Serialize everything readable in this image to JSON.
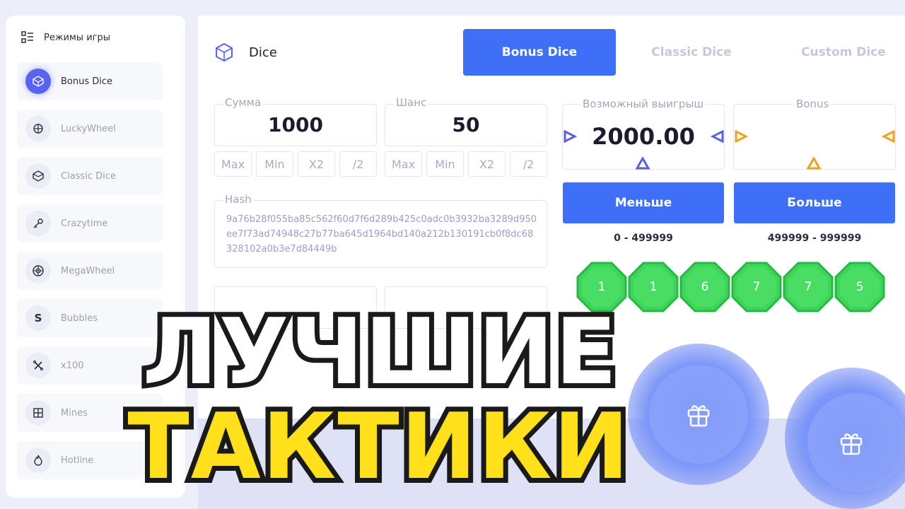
{
  "sidebar": {
    "title": "Режимы игры",
    "title_icon": "list-icon",
    "items": [
      {
        "label": "Bonus Dice",
        "icon": "dice-icon"
      },
      {
        "label": "LuckyWheel",
        "icon": "wheel-icon"
      },
      {
        "label": "Classic Dice",
        "icon": "dice-icon"
      },
      {
        "label": "Crazytime",
        "icon": "key-icon"
      },
      {
        "label": "MegaWheel",
        "icon": "wheel-icon"
      },
      {
        "label": "Bubbles",
        "icon": "bubbles-icon"
      },
      {
        "label": "x100",
        "icon": "x100-icon"
      },
      {
        "label": "Mines",
        "icon": "grid-icon"
      },
      {
        "label": "Hotline",
        "icon": "flame-icon"
      }
    ]
  },
  "header": {
    "title": "Dice",
    "tabs": [
      {
        "label": "Bonus Dice",
        "active": true
      },
      {
        "label": "Classic Dice",
        "active": false
      },
      {
        "label": "Custom Dice",
        "active": false
      }
    ]
  },
  "bet": {
    "amount_label": "Сумма",
    "amount_value": "1000",
    "chance_label": "Шанс",
    "chance_value": "50",
    "amount_buttons": [
      "Max",
      "Min",
      "X2",
      "/2"
    ],
    "chance_buttons": [
      "Max",
      "Min",
      "X2",
      "/2"
    ]
  },
  "hash": {
    "label": "Hash",
    "value": "9a76b28f055ba85c562f60d7f6d289b425c0adc0b3932ba3289d950ee7f73ad74948c27b77ba645d1964bd140a212b130191cb0f8dc68328102a0b3e7d84449b"
  },
  "results": {
    "win_label": "Возможный выигрыш",
    "win_value": "2000.00",
    "bonus_label": "Bonus",
    "less_button": "Меньше",
    "more_button": "Больше",
    "less_range": "0 - 499999",
    "more_range": "499999 - 999999"
  },
  "history": [
    "1",
    "1",
    "6",
    "7",
    "7",
    "5"
  ],
  "overlay": {
    "line1": "ЛУЧШИЕ",
    "line2": "ТАКТИКИ"
  },
  "colors": {
    "accent": "#3f6ef7",
    "win_arrows": "#5a5fe0",
    "bonus_arrows": "#f0a020",
    "history_ball": "#3dd65a",
    "overlay_line1": "#ffffff",
    "overlay_line2": "#ffe01a"
  }
}
